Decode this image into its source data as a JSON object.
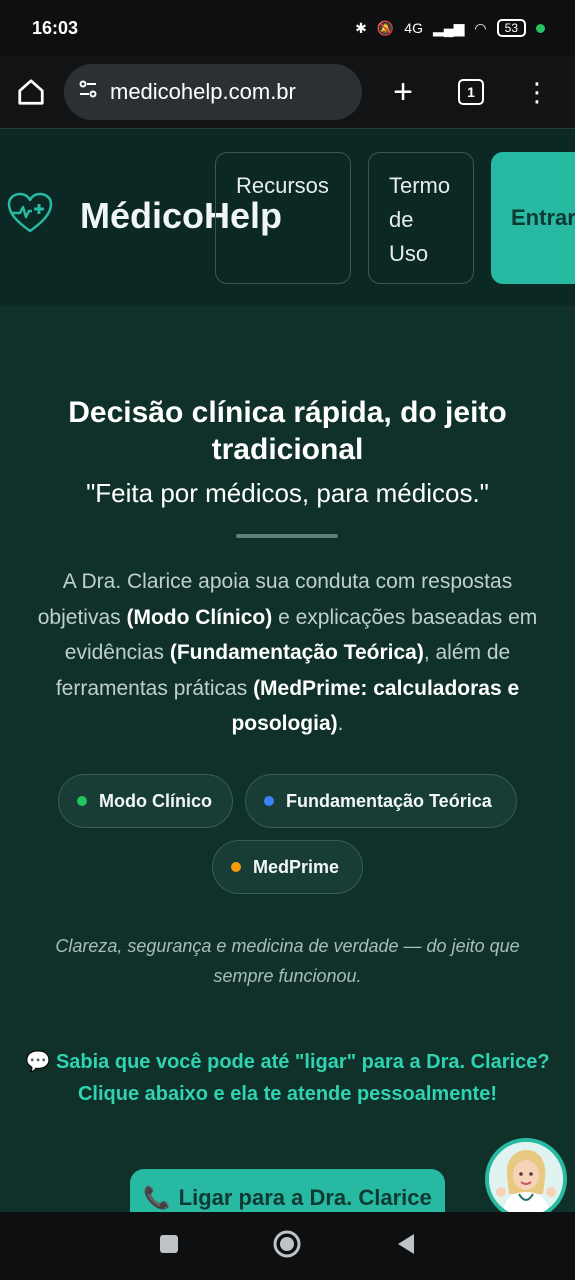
{
  "status_bar": {
    "time": "16:03",
    "network": "4G",
    "battery": "53"
  },
  "browser": {
    "url": "medicohelp.com.br",
    "tab_count": "1"
  },
  "site_nav": {
    "brand": "MédicoHelp",
    "links": [
      "Recursos",
      "Termo de Uso"
    ],
    "login": "Entrar"
  },
  "hero": {
    "title": "Decisão clínica rápida, do jeito tradicional",
    "tagline": "\"Feita por médicos, para médicos.\"",
    "description": {
      "p1": "A Dra. Clarice apoia sua conduta com respostas objetivas ",
      "b1": "(Modo Clínico)",
      "p2": " e explicações baseadas em evidências ",
      "b2": "(Fundamentação Teórica)",
      "p3": ", além de ferramentas práticas ",
      "b3": "(MedPrime: calculadoras e posologia)",
      "p4": "."
    },
    "chips": [
      {
        "label": "Modo Clínico",
        "color": "#22c55e"
      },
      {
        "label": "Fundamentação Teórica",
        "color": "#3b82f6"
      },
      {
        "label": "MedPrime",
        "color": "#f59e0b"
      }
    ],
    "motto": "Clareza, segurança e medicina de verdade — do jeito que sempre funcionou.",
    "promo": "Sabia que você pode até \"ligar\" para a Dra. Clarice? Clique abaixo e ela te atende pessoalmente!",
    "call_button": "Ligar para a Dra. Clarice"
  },
  "colors": {
    "accent": "#27b9a1",
    "promo_text": "#2fd3b2",
    "background": "#0f3129"
  }
}
